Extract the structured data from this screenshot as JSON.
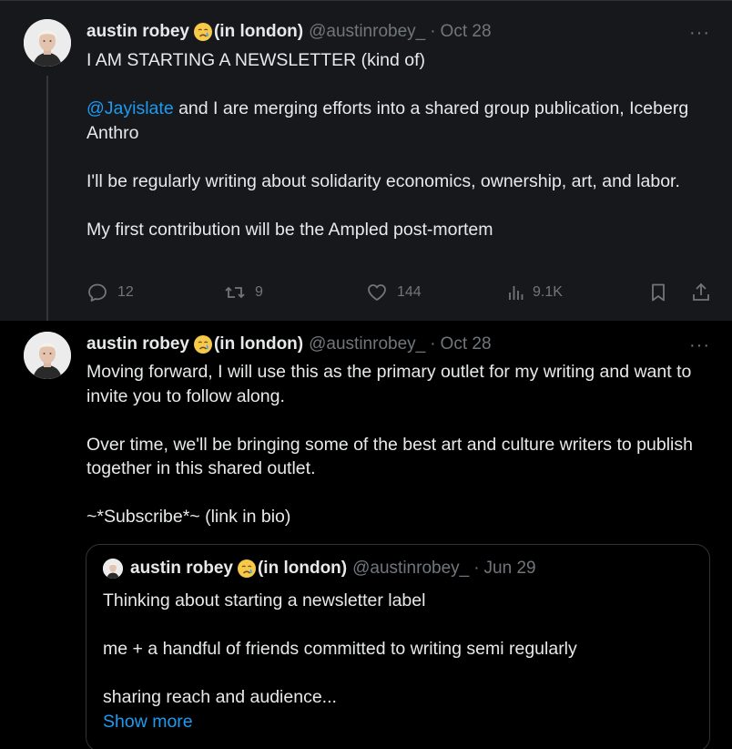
{
  "colors": {
    "background": "#000000",
    "highlight_background": "#16181c",
    "text": "#e7e9ea",
    "muted": "#71767b",
    "accent": "#1d9bf0",
    "border": "#2f3336"
  },
  "tweets": [
    {
      "author": {
        "name": "austin robey",
        "emoji": "crying-face",
        "name_suffix": "(in london)",
        "handle": "@austinrobey_"
      },
      "separator": "·",
      "date": "Oct 28",
      "more": "···",
      "body": {
        "line1": "I AM STARTING A NEWSLETTER (kind of)",
        "mention": "@Jayislate",
        "line2_rest": " and I are merging efforts into a shared group publication, Iceberg Anthro",
        "line3": "I'll be regularly writing about solidarity economics, ownership, art, and labor.",
        "line4": "My first contribution will be the Ampled post-mortem"
      },
      "actions": {
        "replies": "12",
        "reposts": "9",
        "likes": "144",
        "views": "9.1K"
      }
    },
    {
      "author": {
        "name": "austin robey",
        "emoji": "crying-face",
        "name_suffix": "(in london)",
        "handle": "@austinrobey_"
      },
      "separator": "·",
      "date": "Oct 28",
      "more": "···",
      "body": {
        "line1": "Moving forward, I will use this as the primary outlet for my writing and want to invite you to follow along.",
        "line2": "Over time, we'll be bringing some of the best art and culture writers to publish together in this shared outlet.",
        "line3": "~*Subscribe*~ (link in bio)"
      },
      "quote": {
        "author": {
          "name": "austin robey",
          "emoji": "crying-face",
          "name_suffix": "(in london)",
          "handle": "@austinrobey_"
        },
        "separator": "·",
        "date": "Jun 29",
        "line1": "Thinking about starting a newsletter label",
        "line2": "me + a handful of friends committed to writing semi regularly",
        "line3": "sharing reach and audience...",
        "show_more": "Show more"
      }
    }
  ]
}
